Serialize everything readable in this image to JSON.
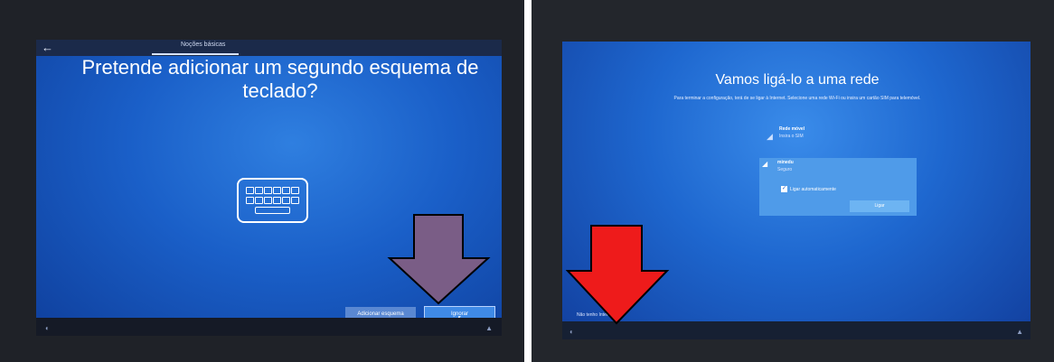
{
  "left_screen": {
    "tab_label": "Noções básicas",
    "title_line1": "Pretende adicionar um segundo esquema de",
    "title_line2": "teclado?",
    "buttons": {
      "add": "Adicionar esquema",
      "skip": "Ignorar"
    },
    "icons": [
      "back-arrow-icon",
      "keyboard-icon",
      "accessibility-icon",
      "volume-icon"
    ]
  },
  "right_screen": {
    "title": "Vamos ligá-lo a uma rede",
    "subtitle": "Para terminar a configuração, terá de se ligar à Internet. Selecione uma rede Wi-Fi ou insira um cartão SIM para telemóvel.",
    "networks": [
      {
        "name": "Rede móvel",
        "status": "Insira o SIM"
      },
      {
        "name": "minedu",
        "status": "Seguro",
        "auto_connect_label": "Ligar automaticamente",
        "auto_connect_checked": true,
        "connect_label": "Ligar"
      }
    ],
    "no_internet_link": "Não tenho Internet",
    "icons": [
      "cellular-signal-icon",
      "wifi-secure-icon",
      "accessibility-icon",
      "volume-icon"
    ]
  },
  "annotations": {
    "left_arrow_color": "#7a5d86",
    "right_arrow_color": "#ee1b1b"
  }
}
